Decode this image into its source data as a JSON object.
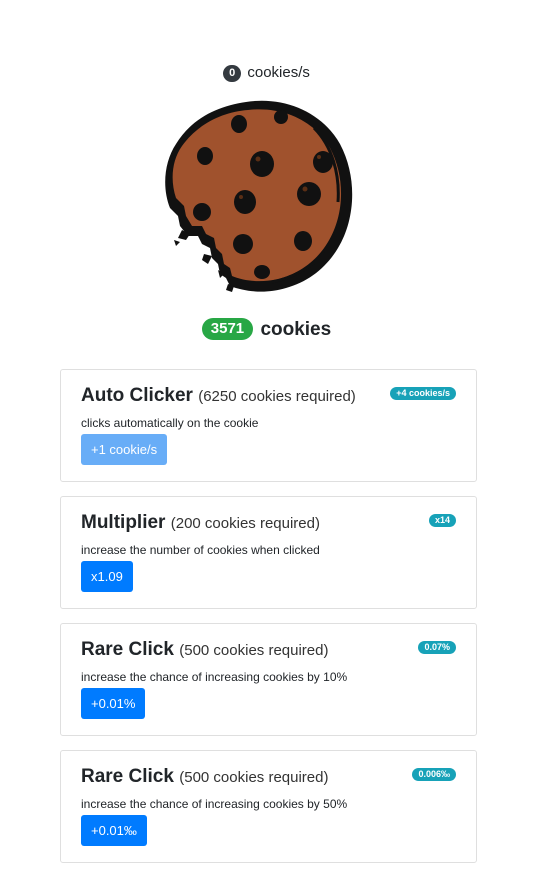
{
  "rate": {
    "value": "0",
    "label": "cookies/s"
  },
  "counter": {
    "value": "3571",
    "label": "cookies"
  },
  "cookie": {
    "icon": "cookie-icon"
  },
  "colors": {
    "primary": "#007bff",
    "success": "#28a745",
    "info": "#17a2b8",
    "dark": "#343a40"
  },
  "upgrades": [
    {
      "name": "Auto Clicker",
      "requirement": "(6250 cookies required)",
      "description": "clicks automatically on the cookie",
      "button": "+1 cookie/s",
      "badge": "+4 cookies/s",
      "disabled": true
    },
    {
      "name": "Multiplier",
      "requirement": "(200 cookies required)",
      "description": "increase the number of cookies when clicked",
      "button": "x1.09",
      "badge": "x14",
      "disabled": false
    },
    {
      "name": "Rare Click",
      "requirement": "(500 cookies required)",
      "description": "increase the chance of increasing cookies by 10%",
      "button": "+0.01%",
      "badge": "0.07%",
      "disabled": false
    },
    {
      "name": "Rare Click",
      "requirement": "(500 cookies required)",
      "description": "increase the chance of increasing cookies by 50%",
      "button": "+0.01‰",
      "badge": "0.006‰",
      "disabled": false
    }
  ]
}
